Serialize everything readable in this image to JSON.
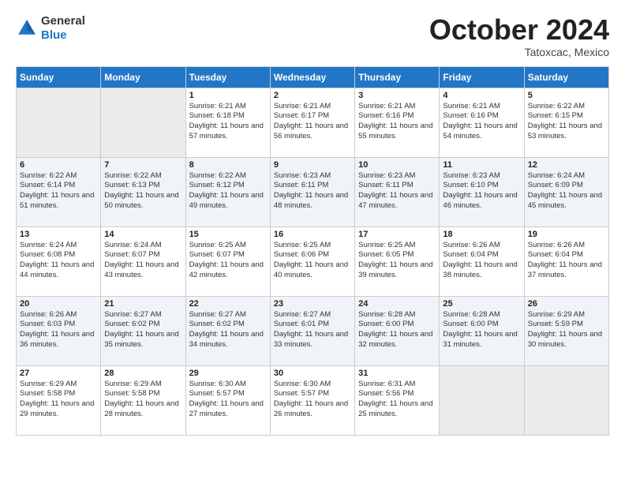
{
  "header": {
    "logo": {
      "general": "General",
      "blue": "Blue"
    },
    "title": "October 2024",
    "subtitle": "Tatoxcac, Mexico"
  },
  "weekdays": [
    "Sunday",
    "Monday",
    "Tuesday",
    "Wednesday",
    "Thursday",
    "Friday",
    "Saturday"
  ],
  "weeks": [
    [
      null,
      null,
      {
        "day": 1,
        "sunrise": "6:21 AM",
        "sunset": "6:18 PM",
        "daylight": "11 hours and 57 minutes."
      },
      {
        "day": 2,
        "sunrise": "6:21 AM",
        "sunset": "6:17 PM",
        "daylight": "11 hours and 56 minutes."
      },
      {
        "day": 3,
        "sunrise": "6:21 AM",
        "sunset": "6:16 PM",
        "daylight": "11 hours and 55 minutes."
      },
      {
        "day": 4,
        "sunrise": "6:21 AM",
        "sunset": "6:16 PM",
        "daylight": "11 hours and 54 minutes."
      },
      {
        "day": 5,
        "sunrise": "6:22 AM",
        "sunset": "6:15 PM",
        "daylight": "11 hours and 53 minutes."
      }
    ],
    [
      {
        "day": 6,
        "sunrise": "6:22 AM",
        "sunset": "6:14 PM",
        "daylight": "11 hours and 51 minutes."
      },
      {
        "day": 7,
        "sunrise": "6:22 AM",
        "sunset": "6:13 PM",
        "daylight": "11 hours and 50 minutes."
      },
      {
        "day": 8,
        "sunrise": "6:22 AM",
        "sunset": "6:12 PM",
        "daylight": "11 hours and 49 minutes."
      },
      {
        "day": 9,
        "sunrise": "6:23 AM",
        "sunset": "6:11 PM",
        "daylight": "11 hours and 48 minutes."
      },
      {
        "day": 10,
        "sunrise": "6:23 AM",
        "sunset": "6:11 PM",
        "daylight": "11 hours and 47 minutes."
      },
      {
        "day": 11,
        "sunrise": "6:23 AM",
        "sunset": "6:10 PM",
        "daylight": "11 hours and 46 minutes."
      },
      {
        "day": 12,
        "sunrise": "6:24 AM",
        "sunset": "6:09 PM",
        "daylight": "11 hours and 45 minutes."
      }
    ],
    [
      {
        "day": 13,
        "sunrise": "6:24 AM",
        "sunset": "6:08 PM",
        "daylight": "11 hours and 44 minutes."
      },
      {
        "day": 14,
        "sunrise": "6:24 AM",
        "sunset": "6:07 PM",
        "daylight": "11 hours and 43 minutes."
      },
      {
        "day": 15,
        "sunrise": "6:25 AM",
        "sunset": "6:07 PM",
        "daylight": "11 hours and 42 minutes."
      },
      {
        "day": 16,
        "sunrise": "6:25 AM",
        "sunset": "6:06 PM",
        "daylight": "11 hours and 40 minutes."
      },
      {
        "day": 17,
        "sunrise": "6:25 AM",
        "sunset": "6:05 PM",
        "daylight": "11 hours and 39 minutes."
      },
      {
        "day": 18,
        "sunrise": "6:26 AM",
        "sunset": "6:04 PM",
        "daylight": "11 hours and 38 minutes."
      },
      {
        "day": 19,
        "sunrise": "6:26 AM",
        "sunset": "6:04 PM",
        "daylight": "11 hours and 37 minutes."
      }
    ],
    [
      {
        "day": 20,
        "sunrise": "6:26 AM",
        "sunset": "6:03 PM",
        "daylight": "11 hours and 36 minutes."
      },
      {
        "day": 21,
        "sunrise": "6:27 AM",
        "sunset": "6:02 PM",
        "daylight": "11 hours and 35 minutes."
      },
      {
        "day": 22,
        "sunrise": "6:27 AM",
        "sunset": "6:02 PM",
        "daylight": "11 hours and 34 minutes."
      },
      {
        "day": 23,
        "sunrise": "6:27 AM",
        "sunset": "6:01 PM",
        "daylight": "11 hours and 33 minutes."
      },
      {
        "day": 24,
        "sunrise": "6:28 AM",
        "sunset": "6:00 PM",
        "daylight": "11 hours and 32 minutes."
      },
      {
        "day": 25,
        "sunrise": "6:28 AM",
        "sunset": "6:00 PM",
        "daylight": "11 hours and 31 minutes."
      },
      {
        "day": 26,
        "sunrise": "6:29 AM",
        "sunset": "5:59 PM",
        "daylight": "11 hours and 30 minutes."
      }
    ],
    [
      {
        "day": 27,
        "sunrise": "6:29 AM",
        "sunset": "5:58 PM",
        "daylight": "11 hours and 29 minutes."
      },
      {
        "day": 28,
        "sunrise": "6:29 AM",
        "sunset": "5:58 PM",
        "daylight": "11 hours and 28 minutes."
      },
      {
        "day": 29,
        "sunrise": "6:30 AM",
        "sunset": "5:57 PM",
        "daylight": "11 hours and 27 minutes."
      },
      {
        "day": 30,
        "sunrise": "6:30 AM",
        "sunset": "5:57 PM",
        "daylight": "11 hours and 26 minutes."
      },
      {
        "day": 31,
        "sunrise": "6:31 AM",
        "sunset": "5:56 PM",
        "daylight": "11 hours and 25 minutes."
      },
      null,
      null
    ]
  ]
}
